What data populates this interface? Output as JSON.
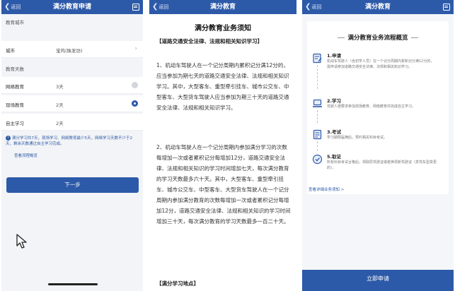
{
  "colors": {
    "primary": "#2d5aa8",
    "background": "#f3f4f7"
  },
  "screen1": {
    "header": {
      "back": "返回",
      "title": "满分教育申请",
      "right_icon": "notes-icon"
    },
    "section_city": "教育城市",
    "city_row": {
      "label": "城市",
      "value": "宝鸡(陕发坊)"
    },
    "section_days": "教育天数",
    "options": [
      {
        "label": "网络教育",
        "days": "3天",
        "selected": false
      },
      {
        "label": "现场教育",
        "days": "2天",
        "selected": true
      },
      {
        "label": "自主学习",
        "days": "2天"
      }
    ],
    "tip": "满分学习共7天，现场学习、网络教育最少5天，网络学习天数不少于2天，剩余天数通过自主学习完成。",
    "link": "查看流程概览",
    "next_button": "下一步"
  },
  "screen2": {
    "header": {
      "back": "返回",
      "title": "满分教育"
    },
    "title": "满分教育业务须知",
    "heading1": "【道路交通安全法律、法规和相关知识学习】",
    "para1": "1、机动车驾驶人在一个记分周期内累积记分满12分的，应当参加为期七天的道路交通安全法律、法规和相关知识学习。其中，大型客车、重型牵引挂车、城市公交车、中型客车、大型货车驾驶人应当参加为期三十天的道路交通安全法律、法规和相关知识学习。",
    "para2": "2、机动车驾驶人在一个记分周期内参加满分学习的次数每增加一次或者累积记分每增加12分，道路交通安全法律、法规和相关知识的学习时间增加七天，每次满分教育的学习天数最多六十天。其中，大型客车、重型牵引挂车、城市公交车、中型客车、大型货车驾驶人在一个记分周期内参加满分教育的次数每增加一次或者累积记分每增加12分，道路交通安全法律、法规和相关知识的学习时间增加三十天，每次满分教育的学习天数最多一百二十天。",
    "heading2": "【满分学习地点】"
  },
  "screen3": {
    "header": {
      "back": "返回",
      "title": "满分教育"
    },
    "card_title": "满分教育业务流程概览",
    "steps": [
      {
        "title": "1.申请",
        "desc": "机动车驾驶人（含初学人员）在一个记分周期内累积记分满12分的，需申请参加道路交通安全法律、法规和相关知识学习。",
        "icon": "application-form-icon"
      },
      {
        "title": "2.学习",
        "desc": "驾驶人按要求参加现场教育、网络教育并完成自主学习。",
        "icon": "laptop-icon"
      },
      {
        "title": "3.考试",
        "desc": "学习期限届满后，预约相关科目考试。",
        "icon": "exam-paper-icon"
      },
      {
        "title": "5.取证",
        "desc": "所有科目考试合格后，领取原驾驶证或者换领新驾驶证（发驾车型变更的）。",
        "icon": "certificate-icon"
      }
    ],
    "detail_link": "查看详细业务须知 >",
    "apply_button": "立即申请"
  }
}
